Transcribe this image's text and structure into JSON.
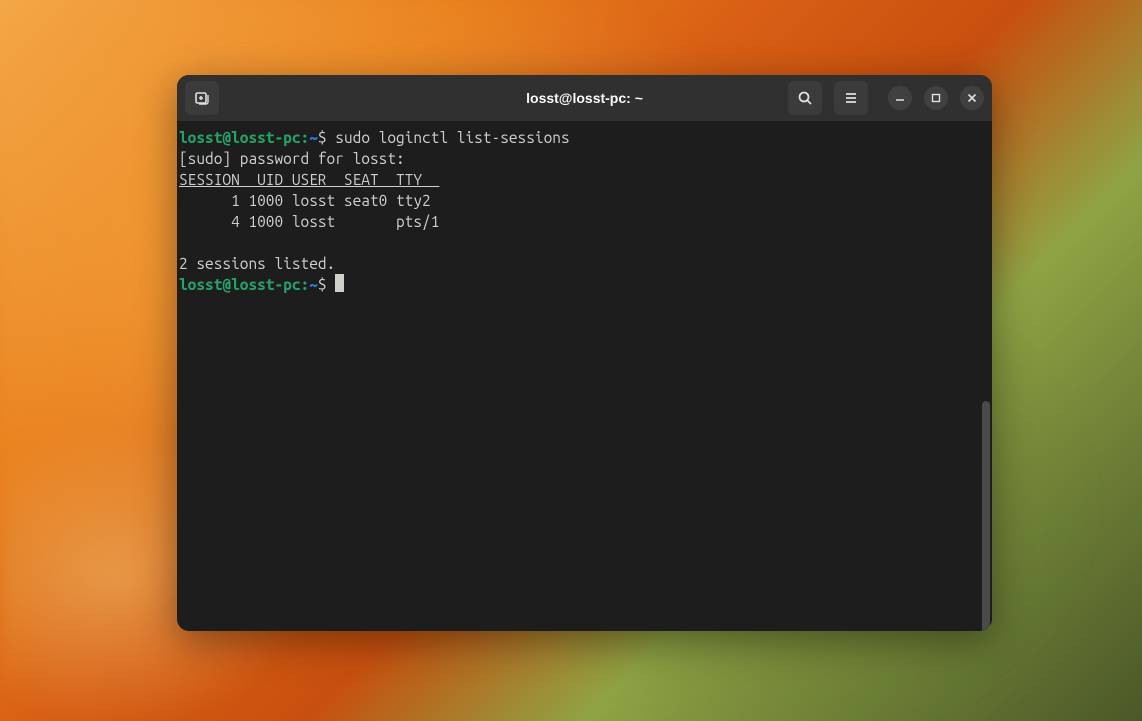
{
  "window": {
    "title": "losst@losst-pc: ~"
  },
  "prompt": {
    "user_host": "losst@losst-pc",
    "colon": ":",
    "cwd": "~",
    "symbol": "$"
  },
  "lines": {
    "cmd1": "sudo loginctl list-sessions",
    "sudo_prompt": "[sudo] password for losst:",
    "header": "SESSION  UID USER  SEAT  TTY  ",
    "row1": "      1 1000 losst seat0 tty2 ",
    "row2": "      4 1000 losst       pts/1",
    "blank": "",
    "summary": "2 sessions listed."
  },
  "icons": {
    "new_tab": "new-tab-icon",
    "search": "search-icon",
    "menu": "hamburger-icon",
    "minimize": "minimize-icon",
    "maximize": "maximize-icon",
    "close": "close-icon"
  }
}
